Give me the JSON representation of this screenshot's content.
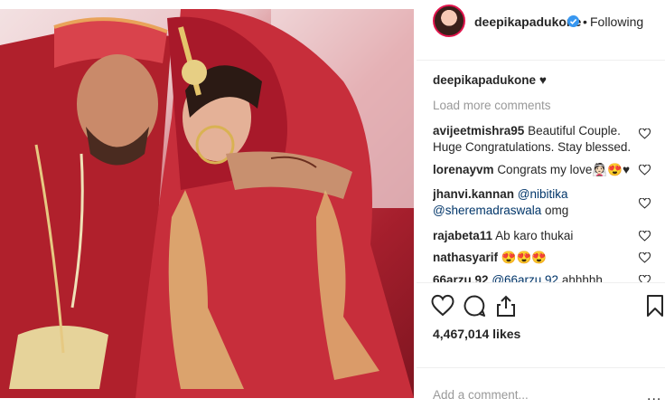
{
  "post": {
    "username": "deepikapadukone",
    "follow_separator": "•",
    "follow_status": "Following",
    "caption_user": "deepikapadukone",
    "caption_text": "♥",
    "load_more": "Load more comments",
    "likes": "4,467,014 likes",
    "add_comment_placeholder": "Add a comment...",
    "more_options": "..."
  },
  "comments": [
    {
      "user": "avijeetmishra95",
      "text": "Beautiful Couple. Huge Congratulations. Stay blessed."
    },
    {
      "user": "lorenayvm",
      "text": "Congrats my love👰🏻😍♥"
    },
    {
      "user": "jhanvi.kannan",
      "mention1": "@nibitika",
      "mention2": "@sheremadraswala",
      "text": "omg"
    },
    {
      "user": "rajabeta11",
      "text": "Ab karo thukai"
    },
    {
      "user": "nathasyarif",
      "text": "😍😍😍"
    },
    {
      "user": "66arzu.92",
      "mention1": "@66arzu.92",
      "text": "ahhhhh"
    }
  ],
  "colors": {
    "verified": "#3897f0",
    "accent_ring": "#e0144c",
    "muted": "#999999"
  }
}
